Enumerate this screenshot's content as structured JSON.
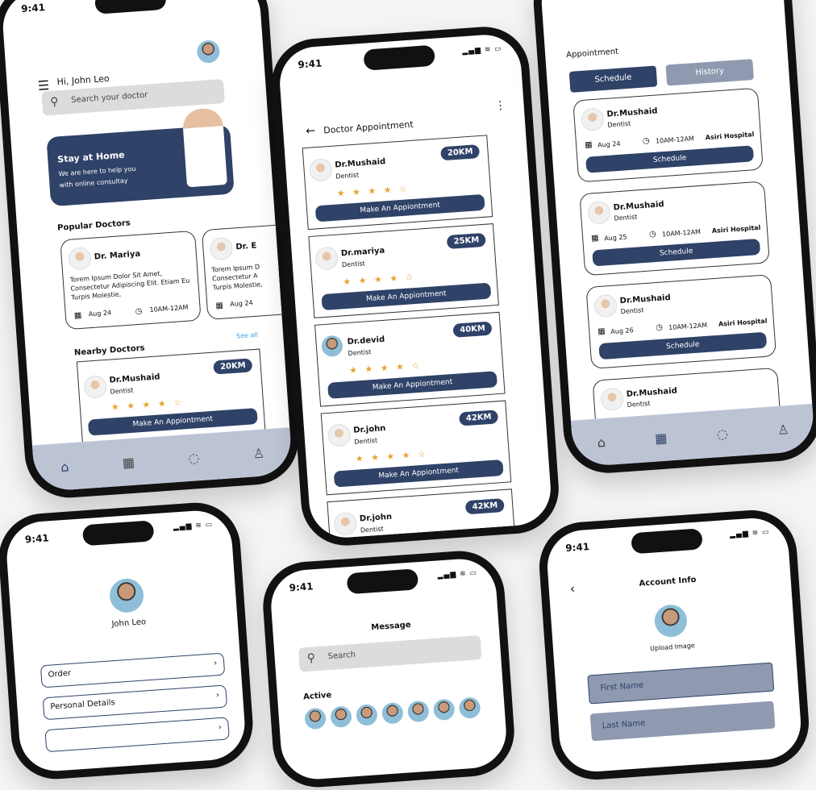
{
  "status": {
    "time": "9:41",
    "signal": "▂▄▆ ≋ ▭"
  },
  "home": {
    "greeting": "Hi, John Leo",
    "search_placeholder": "Search your doctor",
    "banner": {
      "title": "Stay at Home",
      "line1": "We are here to help you",
      "line2": "with online consultay"
    },
    "popular_title": "Popular Doctors",
    "popular": [
      {
        "name": "Dr. Mariya",
        "text": "Torem Ipsum Dolor Sit Amet, Consectetur Adipiscing Elit. Etiam Eu Turpis Molestie,",
        "date": "Aug 24",
        "time": "10AM-12AM"
      },
      {
        "name": "Dr. E",
        "text": "Torem Ipsum D Consectetur A Turpis Molestie,",
        "date": "Aug 24"
      }
    ],
    "nearby_title": "Nearby Doctors",
    "see_all": "See all",
    "nearby": {
      "name": "Dr.Mushaid",
      "spec": "Dentist",
      "distance": "20KM",
      "stars": "★ ★ ★ ★ ☆",
      "cta": "Make An Appiontment"
    }
  },
  "appt": {
    "title": "Doctor Appointment",
    "items": [
      {
        "name": "Dr.Mushaid",
        "spec": "Dentist",
        "distance": "20KM",
        "stars": "★ ★ ★ ★ ☆",
        "cta": "Make An Appiontment"
      },
      {
        "name": "Dr.mariya",
        "spec": "Dentist",
        "distance": "25KM",
        "stars": "★ ★ ★ ★ ☆",
        "cta": "Make An Appiontment"
      },
      {
        "name": "Dr.devid",
        "spec": "Dentist",
        "distance": "40KM",
        "stars": "★ ★ ★ ★ ☆",
        "cta": "Make An Appiontment"
      },
      {
        "name": "Dr.john",
        "spec": "Dentist",
        "distance": "42KM",
        "stars": "★ ★ ★ ★ ☆",
        "cta": "Make An Appiontment"
      },
      {
        "name": "Dr.john",
        "spec": "Dentist",
        "distance": "42KM",
        "stars": "★ ★ ★ ★ ☆"
      }
    ]
  },
  "schedule": {
    "title": "Appointment",
    "tab_schedule": "Schedule",
    "tab_history": "History",
    "items": [
      {
        "name": "Dr.Mushaid",
        "spec": "Dentist",
        "date": "Aug 24",
        "time": "10AM-12AM",
        "place": "Asiri Hospital",
        "cta": "Schedule"
      },
      {
        "name": "Dr.Mushaid",
        "spec": "Dentist",
        "date": "Aug 25",
        "time": "10AM-12AM",
        "place": "Asiri Hospital",
        "cta": "Schedule"
      },
      {
        "name": "Dr.Mushaid",
        "spec": "Dentist",
        "date": "Aug 26",
        "time": "10AM-12AM",
        "place": "Asiri Hospital",
        "cta": "Schedule"
      },
      {
        "name": "Dr.Mushaid",
        "spec": "Dentist"
      }
    ]
  },
  "profile": {
    "name": "John Leo",
    "items": [
      "Order",
      "Personal Details"
    ]
  },
  "message": {
    "title": "Message",
    "search_placeholder": "Search",
    "active": "Active"
  },
  "account": {
    "title": "Account Info",
    "upload": "Upload Image",
    "first_name": "First Name",
    "last_name": "Last Name"
  }
}
